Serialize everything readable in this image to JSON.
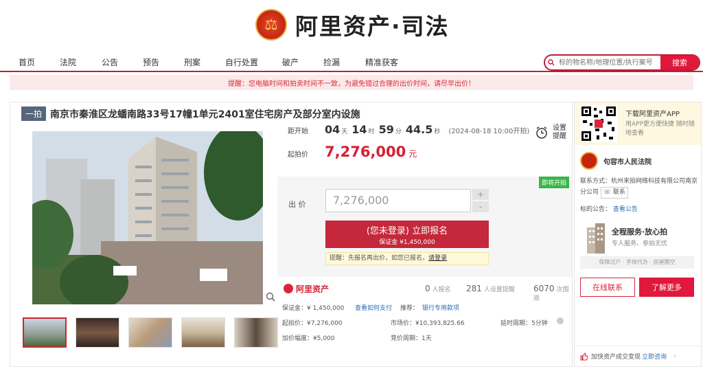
{
  "brand": {
    "name": "阿里资产·司法",
    "emblem_icon": "court-emblem-icon"
  },
  "nav": {
    "items": [
      "首页",
      "法院",
      "公告",
      "预告",
      "刑案",
      "自行处置",
      "破产",
      "捡漏",
      "精准获客"
    ],
    "search_placeholder": "标的物名称/地理位置/执行案号",
    "search_button": "搜索"
  },
  "notice": "提醒：您电脑时间和拍卖时间不一致，为避免错过合理的出价时间，请尽早出价！",
  "listing": {
    "tag": "一拍",
    "title": "南京市秦淮区龙蟠南路33号17幢1单元2401室住宅房产及部分室内设施",
    "countdown_label": "距开始",
    "countdown": {
      "days": "04",
      "days_unit": "天",
      "hours": "14",
      "hours_unit": "时",
      "minutes": "59",
      "minutes_unit": "分",
      "seconds": "44.5",
      "seconds_unit": "秒"
    },
    "start_time": "(2024-08-18 10:00开拍)",
    "reminder_label": "设置\n提醒",
    "start_price_label": "起拍价",
    "start_price": "7,276,000",
    "start_price_unit": "元",
    "status_tag": "即将开拍",
    "bid_label": "出 价",
    "bid_value": "7,276,000",
    "stepper_up": "+",
    "stepper_down": "-",
    "apply_button": "(您未登录) 立即报名",
    "apply_deposit": "保证金 ¥1,450,000",
    "login_tip_prefix": "提醒：先报名再出价，如您已报名，",
    "login_tip_link": "请登录"
  },
  "stats": {
    "platform": "阿里资产",
    "applicants": "0",
    "applicants_label": "人报名",
    "reminders": "281",
    "reminders_label": "人设置提醒",
    "views": "6070",
    "views_label": "次围观"
  },
  "details": {
    "deposit": "保证金：¥ 1,450,000",
    "deposit_link": "查看如何支付",
    "recommend_label": "推荐：",
    "recommend_link": "银行专用款项",
    "start_price": "起拍价：¥7,276,000",
    "market_price": "市场价：¥10,393,825.66",
    "delay": "延时周期：5分钟",
    "increment": "加价幅度：¥5,000",
    "auction_period": "竞价周期：1天"
  },
  "sidebar": {
    "app_title": "下载阿里资产APP",
    "app_desc": "用APP更方便快捷 随时随地查看",
    "court_name": "句容市人民法院",
    "contact_label": "联系方式：",
    "contact_company": "杭州来拍网络科技有限公司南京分公司",
    "contact_button": "联系",
    "announce_label": "标的公告：",
    "announce_link": "查看公告",
    "service_title": "全程服务·放心拍",
    "service_sub": "专人服务、参拍无忧",
    "service_tags": "保障过户 · 手续代办 · 房屋腾空",
    "online_button": "在线联系",
    "more_button": "了解更多",
    "footer_text": "加快资产成交变现",
    "footer_link": "立即咨询"
  },
  "colors": {
    "accent": "#e0183b",
    "price": "#d61f33",
    "link": "#2b6cb6"
  }
}
